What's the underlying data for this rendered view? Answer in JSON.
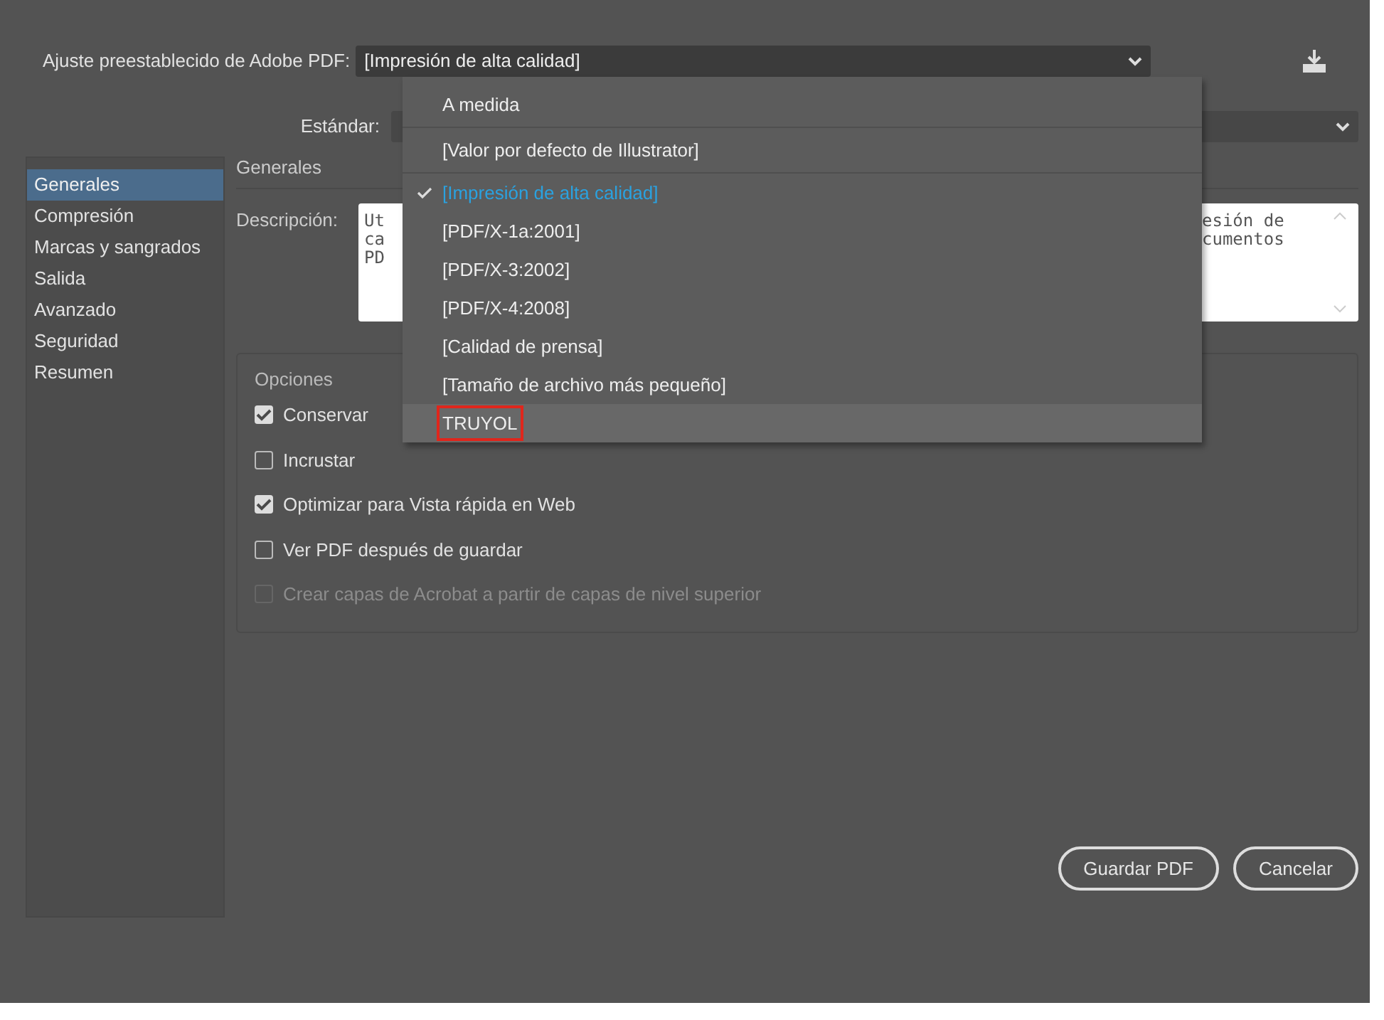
{
  "preset": {
    "label": "Ajuste preestablecido de Adobe PDF:",
    "value": "[Impresión de alta calidad]"
  },
  "standard": {
    "label": "Estándar:"
  },
  "sidebar": {
    "items": [
      {
        "label": "Generales",
        "selected": true
      },
      {
        "label": "Compresión",
        "selected": false
      },
      {
        "label": "Marcas y sangrados",
        "selected": false
      },
      {
        "label": "Salida",
        "selected": false
      },
      {
        "label": "Avanzado",
        "selected": false
      },
      {
        "label": "Seguridad",
        "selected": false
      },
      {
        "label": "Resumen",
        "selected": false
      }
    ]
  },
  "section_title": "Generales",
  "description": {
    "label": "Descripción:",
    "left_lines": [
      "Ut",
      "ca",
      "PD"
    ],
    "right_lines": [
      "esión de",
      "cumentos"
    ]
  },
  "options": {
    "title": "Opciones",
    "items": [
      {
        "label": "Conservar",
        "checked": true,
        "disabled": false
      },
      {
        "label": "Incrustar",
        "checked": false,
        "disabled": false
      },
      {
        "label": "Optimizar para Vista rápida en Web",
        "checked": true,
        "disabled": false
      },
      {
        "label": "Ver PDF después de guardar",
        "checked": false,
        "disabled": false
      },
      {
        "label": "Crear capas de Acrobat a partir de capas de nivel superior",
        "checked": false,
        "disabled": true
      }
    ]
  },
  "menu": {
    "items": [
      {
        "label": "A medida",
        "selected": false,
        "hovered": false,
        "outlined": false,
        "divider_after": true
      },
      {
        "label": "[Valor por defecto de Illustrator]",
        "selected": false,
        "hovered": false,
        "outlined": false,
        "divider_after": true
      },
      {
        "label": "[Impresión de alta calidad]",
        "selected": true,
        "hovered": false,
        "outlined": false,
        "divider_after": false
      },
      {
        "label": "[PDF/X-1a:2001]",
        "selected": false,
        "hovered": false,
        "outlined": false,
        "divider_after": false
      },
      {
        "label": "[PDF/X-3:2002]",
        "selected": false,
        "hovered": false,
        "outlined": false,
        "divider_after": false
      },
      {
        "label": "[PDF/X-4:2008]",
        "selected": false,
        "hovered": false,
        "outlined": false,
        "divider_after": false
      },
      {
        "label": "[Calidad de prensa]",
        "selected": false,
        "hovered": false,
        "outlined": false,
        "divider_after": false
      },
      {
        "label": "[Tamaño de archivo más pequeño]",
        "selected": false,
        "hovered": false,
        "outlined": false,
        "divider_after": false
      },
      {
        "label": "TRUYOL",
        "selected": false,
        "hovered": true,
        "outlined": true,
        "divider_after": false
      }
    ]
  },
  "buttons": [
    "Guardar PDF",
    "Cancelar"
  ]
}
